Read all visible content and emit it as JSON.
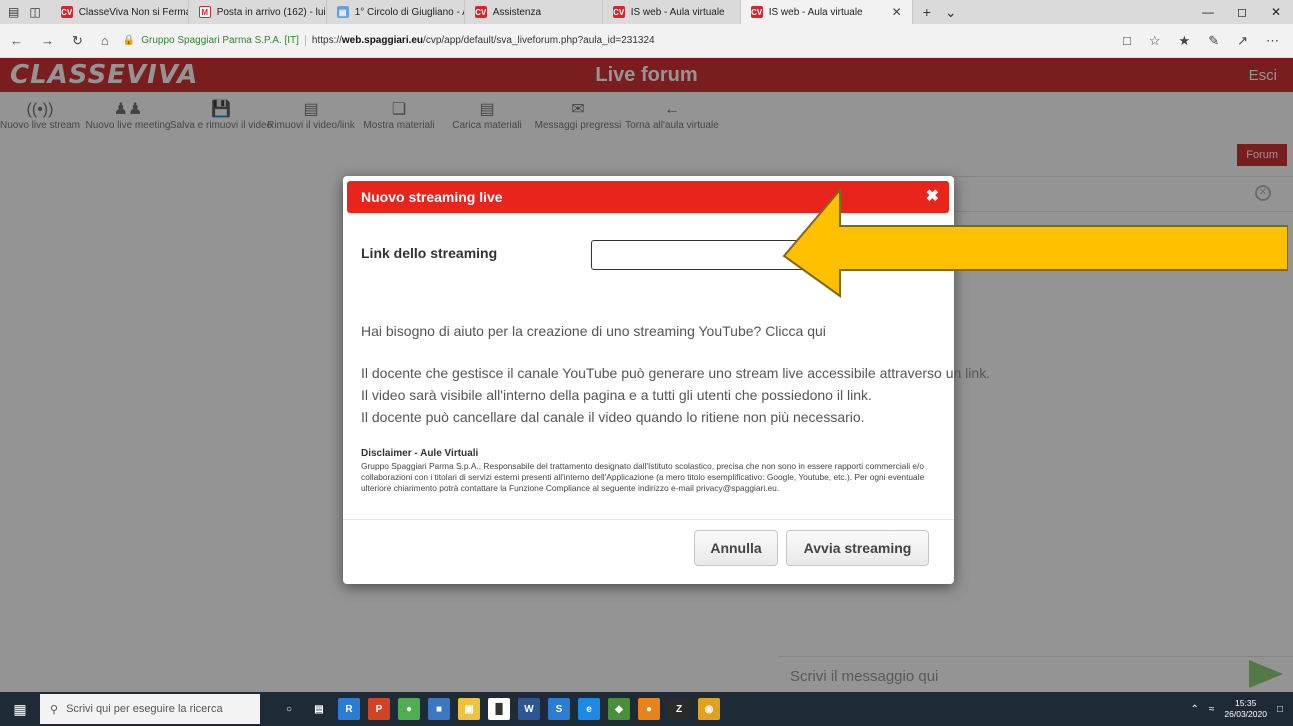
{
  "browser": {
    "tabs": [
      {
        "label": "ClasseViva Non si Ferma",
        "icon": "classeviva-favicon",
        "active": false
      },
      {
        "label": "Posta in arrivo (162) - luisa.a",
        "icon": "mail-favicon",
        "active": false
      },
      {
        "label": "1° Circolo di Giugliano - Av",
        "icon": "document-favicon",
        "active": false
      },
      {
        "label": "Assistenza",
        "icon": "classeviva-favicon",
        "active": false
      },
      {
        "label": "IS web - Aula virtuale",
        "icon": "classeviva-favicon",
        "active": false
      },
      {
        "label": "IS web - Aula virtuale",
        "icon": "classeviva-favicon",
        "active": true
      }
    ],
    "site_identity": "Gruppo Spaggiari Parma S.P.A. [IT]",
    "url_prefix": "https://",
    "url_domain": "web.spaggiari.eu",
    "url_path": "/cvp/app/default/sva_liveforum.php?aula_id=231324"
  },
  "site": {
    "logo": "CLASSEVIVA",
    "title": "Live forum",
    "logout": "Esci"
  },
  "toolbar": [
    {
      "label": "Nuovo live stream",
      "icon": "broadcast-icon"
    },
    {
      "label": "Nuovo live meeting",
      "icon": "people-icon"
    },
    {
      "label": "Salva e rimuovi il video",
      "icon": "save-icon"
    },
    {
      "label": "Rimuovi il video/link",
      "icon": "trash-icon"
    },
    {
      "label": "Mostra materiali",
      "icon": "files-icon"
    },
    {
      "label": "Carica materiali",
      "icon": "upload-doc-icon"
    },
    {
      "label": "Messaggi pregressi",
      "icon": "messages-icon"
    },
    {
      "label": "Torna all'aula virtuale",
      "icon": "back-arrow-icon"
    }
  ],
  "forum": {
    "tab_label": "Forum",
    "message_placeholder": "Scrivi il messaggio qui"
  },
  "modal": {
    "title": "Nuovo streaming live",
    "field_label": "Link dello streaming",
    "field_value": "",
    "help_text": "Hai bisogno di aiuto per la creazione di uno streaming YouTube? Clicca qui",
    "description": [
      "Il docente che gestisce il canale YouTube può generare uno stream live accessibile attraverso un link.",
      "Il video sarà visibile all'interno della pagina e a tutti gli utenti che possiedono il link.",
      "Il docente può cancellare dal canale il video quando lo ritiene non più necessario."
    ],
    "disclaimer_title": "Disclaimer - Aule Virtuali",
    "disclaimer_text": "Gruppo Spaggiari Parma S.p.A., Responsabile del trattamento designato dall'Istituto scolastico, precisa che non sono in essere rapporti commerciali e/o collaborazioni con i titolari di servizi esterni presenti all'interno dell'Applicazione (a mero titolo esemplificativo: Google, Youtube, etc.). Per ogni eventuale ulteriore chiarimento potrà contattare la Funzione Compliance al seguente indirizzo e-mail privacy@spaggiari.eu.",
    "cancel_label": "Annulla",
    "start_label": "Avvia streaming"
  },
  "annotation": {
    "color": "#ffc000",
    "outline": "#7a6a1a",
    "points_to": "link-input"
  },
  "taskbar": {
    "search_placeholder": "Scrivi qui per eseguire la ricerca",
    "time": "15:35",
    "date": "26/03/2020"
  },
  "colors": {
    "brand_red": "#d03234",
    "modal_header": "#e8241c",
    "send_green": "#8fd17a"
  }
}
